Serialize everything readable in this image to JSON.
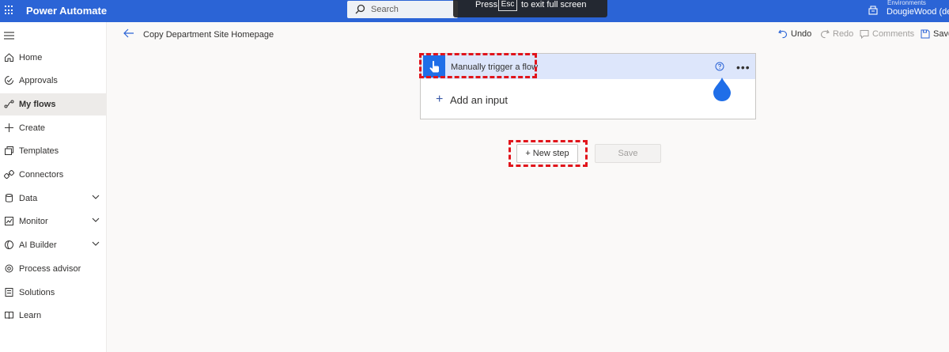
{
  "app": {
    "title": "Power Automate"
  },
  "search": {
    "label": "Search"
  },
  "fullscreen_toast": {
    "press": "Press",
    "key": "Esc",
    "rest": "to exit full screen"
  },
  "environment": {
    "label": "Environments",
    "name": "DougieWood (def"
  },
  "sidebar": {
    "items": [
      {
        "label": "Home",
        "icon": "home-icon"
      },
      {
        "label": "Approvals",
        "icon": "approvals-icon"
      },
      {
        "label": "My flows",
        "icon": "flows-icon",
        "active": true
      },
      {
        "label": "Create",
        "icon": "plus-icon"
      },
      {
        "label": "Templates",
        "icon": "templates-icon"
      },
      {
        "label": "Connectors",
        "icon": "connectors-icon"
      },
      {
        "label": "Data",
        "icon": "data-icon",
        "expandable": true
      },
      {
        "label": "Monitor",
        "icon": "monitor-icon",
        "expandable": true
      },
      {
        "label": "AI Builder",
        "icon": "ai-builder-icon",
        "expandable": true
      },
      {
        "label": "Process advisor",
        "icon": "process-advisor-icon"
      },
      {
        "label": "Solutions",
        "icon": "solutions-icon"
      },
      {
        "label": "Learn",
        "icon": "learn-icon"
      }
    ]
  },
  "header": {
    "flow_name": "Copy Department Site Homepage"
  },
  "commands": {
    "undo": "Undo",
    "redo": "Redo",
    "comments": "Comments",
    "save": "Save"
  },
  "trigger": {
    "title": "Manually trigger a flow",
    "add_input": "Add an input"
  },
  "actions": {
    "new_step": "+ New step",
    "save": "Save"
  },
  "colors": {
    "topbar": "#2b64d6",
    "accent": "#1f6ee8",
    "annotation": "#e1141b"
  }
}
